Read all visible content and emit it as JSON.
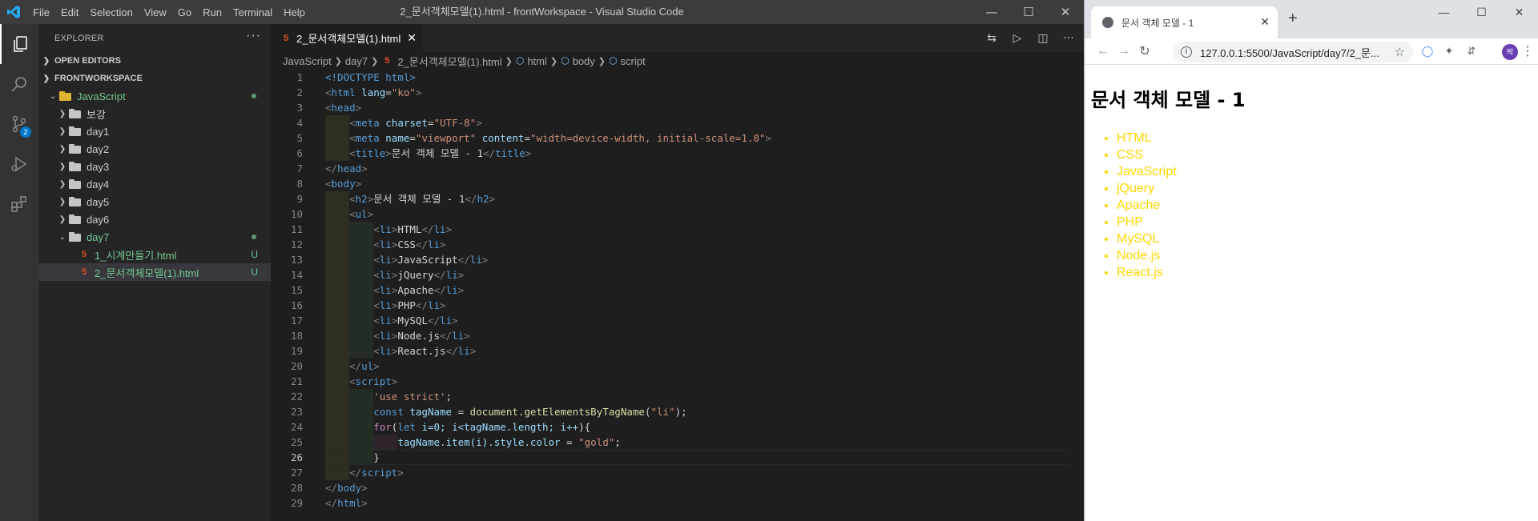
{
  "vscode": {
    "menu": [
      "File",
      "Edit",
      "Selection",
      "View",
      "Go",
      "Run",
      "Terminal",
      "Help"
    ],
    "window_title": "2_문서객체모델(1).html - frontWorkspace - Visual Studio Code",
    "scm_badge": "2",
    "explorer_title": "EXPLORER",
    "open_editors": "OPEN EDITORS",
    "workspace": "FRONTWORKSPACE",
    "tree": {
      "root": "JavaScript",
      "folders": [
        "보강",
        "day1",
        "day2",
        "day3",
        "day4",
        "day5",
        "day6"
      ],
      "open_folder": "day7",
      "files": [
        {
          "name": "1_시계만들기.html",
          "status": "U"
        },
        {
          "name": "2_문서객체모델(1).html",
          "status": "U"
        }
      ]
    },
    "tab": "2_문서객체모델(1).html",
    "breadcrumb": [
      "JavaScript",
      "day7",
      "2_문서객체모델(1).html",
      "html",
      "body",
      "script"
    ],
    "line_numbers": [
      "1",
      "2",
      "3",
      "4",
      "5",
      "6",
      "7",
      "8",
      "9",
      "10",
      "11",
      "12",
      "13",
      "14",
      "15",
      "16",
      "17",
      "18",
      "19",
      "20",
      "21",
      "22",
      "23",
      "24",
      "25",
      "26",
      "27",
      "28",
      "29"
    ],
    "code": {
      "doctype": "<!DOCTYPE html>",
      "lang_value": "\"ko\"",
      "charset_value": "\"UTF-8\"",
      "viewport_name": "\"viewport\"",
      "viewport_content": "\"width=device-width, initial-scale=1.0\"",
      "title_text": "문서 객체 모델 - 1",
      "h2_text": "문서 객체 모델 - 1",
      "li_items": [
        "HTML",
        "CSS",
        "JavaScript",
        "jQuery",
        "Apache",
        "PHP",
        "MySQL",
        "Node.js",
        "React.js"
      ],
      "use_strict": "'use strict'",
      "const_var": "tagName",
      "get_call": "document.getElementsByTagName",
      "get_arg": "\"li\"",
      "for_head": "i=0; i<tagName.length; i++",
      "loop_body": "tagName.item(i).style.color",
      "loop_value": "\"gold\""
    }
  },
  "browser": {
    "tab_title": "문서 객체 모델 - 1",
    "url": "127.0.0.1:5500/JavaScript/day7/2_문...",
    "avatar_initial": "박",
    "heading": "문서 객체 모델 - 1",
    "list": [
      "HTML",
      "CSS",
      "JavaScript",
      "jQuery",
      "Apache",
      "PHP",
      "MySQL",
      "Node.js",
      "React.js"
    ],
    "list_color": "#ffd700"
  }
}
